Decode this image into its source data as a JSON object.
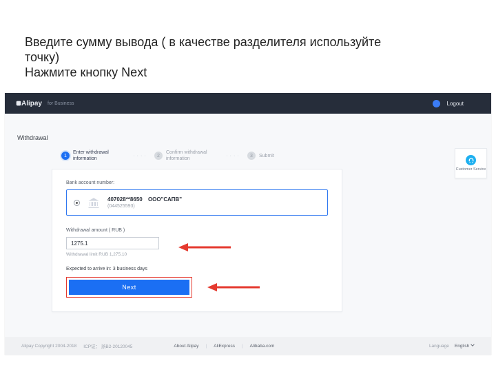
{
  "instruction_line1": "Введите сумму вывода ( в качестве разделителя используйте точку)",
  "instruction_line2": "Нажмите кнопку Next",
  "topbar": {
    "brand": "Alipay",
    "sub": "for Business",
    "logout": "Logout"
  },
  "page_title": "Withdrawal",
  "steps": {
    "s1": "Enter withdrawal information",
    "s2": "Confirm withdrawal information",
    "s3": "Submit"
  },
  "bank": {
    "label": "Bank account number:",
    "masked": "407028**8650",
    "org": "ООО\"САПВ\"",
    "sub": "(044525593)"
  },
  "amount": {
    "label": "Withdrawal amount ( RUB )",
    "value": "1275.1",
    "limit": "Withdrawal limit RUB 1,275.10"
  },
  "eta": "Expected to arrive in: 3 business days",
  "next": "Next",
  "customer_service": "Customer Service",
  "footer": {
    "copyright": "Alipay Copyright 2004-2018",
    "icp": "ICP证： 浙B2-20120045",
    "about": "About Alipay",
    "ae": "AliExpress",
    "alibaba": "Alibaba.com",
    "language_label": "Language",
    "language": "English"
  }
}
